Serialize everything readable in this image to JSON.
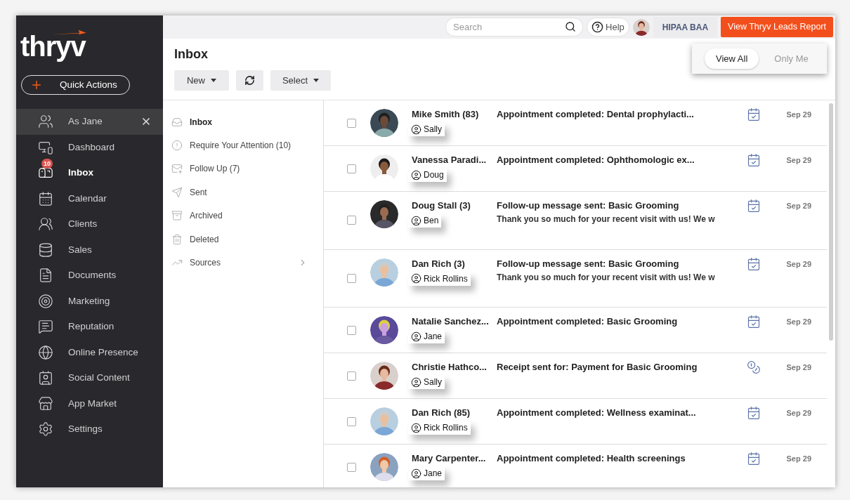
{
  "logo": {
    "text": "thryv"
  },
  "quick_actions": {
    "label": "Quick Actions"
  },
  "sidebar": {
    "items": [
      {
        "label": "As Jane",
        "selected": false,
        "kind": "impersonation",
        "closable": true
      },
      {
        "label": "Dashboard",
        "selected": false,
        "kind": "link"
      },
      {
        "label": "Inbox",
        "selected": true,
        "badge": "10",
        "kind": "link"
      },
      {
        "label": "Calendar",
        "selected": false,
        "kind": "link"
      },
      {
        "label": "Clients",
        "selected": false,
        "kind": "link"
      },
      {
        "label": "Sales",
        "selected": false,
        "kind": "link"
      },
      {
        "label": "Documents",
        "selected": false,
        "kind": "link"
      },
      {
        "label": "Marketing",
        "selected": false,
        "kind": "link"
      },
      {
        "label": "Reputation",
        "selected": false,
        "kind": "link"
      },
      {
        "label": "Online Presence",
        "selected": false,
        "kind": "link"
      },
      {
        "label": "Social Content",
        "selected": false,
        "kind": "link"
      },
      {
        "label": "App Market",
        "selected": false,
        "kind": "link"
      },
      {
        "label": "Settings",
        "selected": false,
        "kind": "link"
      }
    ]
  },
  "top_bar": {
    "search": {
      "placeholder": "Search"
    },
    "help": "Help",
    "hipaa": "HIPAA BAA",
    "leads_button": "View Thryv Leads Report"
  },
  "page": {
    "title": "Inbox",
    "buttons": [
      {
        "label": "New",
        "kind": "dropdown"
      },
      {
        "kind": "refresh"
      },
      {
        "label": "Select",
        "kind": "dropdown"
      }
    ]
  },
  "view_toggle": [
    {
      "label": "View All",
      "selected": true
    },
    {
      "label": "Only Me",
      "selected": false
    }
  ],
  "folders": [
    {
      "label": "Inbox",
      "selected": true
    },
    {
      "label": "Require Your Attention (10)",
      "selected": false
    },
    {
      "label": "Follow Up (7)",
      "selected": false
    },
    {
      "label": "Sent",
      "selected": false
    },
    {
      "label": "Archived",
      "selected": false
    },
    {
      "label": "Deleted",
      "selected": false
    },
    {
      "label": "Sources",
      "selected": false,
      "expandable": true
    }
  ],
  "messages": [
    {
      "name": "Mike Smith (83)",
      "assignee": "Sally",
      "subject": "Appointment completed: Dental prophylacti...",
      "kind": "appointment",
      "date": "Sep 29",
      "checked": false
    },
    {
      "name": "Vanessa Paradi...",
      "assignee": "Doug",
      "subject": "Appointment completed: Ophthomologic ex...",
      "kind": "appointment",
      "date": "Sep 29",
      "checked": false
    },
    {
      "name": "Doug Stall (3)",
      "assignee": "Ben",
      "subject": "Follow-up message sent: Basic Grooming",
      "preview": "Thank you so much for your recent visit with us! We w",
      "kind": "appointment",
      "date": "Sep 29",
      "checked": false
    },
    {
      "name": "Dan Rich (3)",
      "assignee": "Rick Rollins",
      "subject": "Follow-up message sent: Basic Grooming",
      "preview": "Thank you so much for your recent visit with us! We w",
      "kind": "appointment",
      "date": "Sep 29",
      "checked": false
    },
    {
      "name": "Natalie Sanchez...",
      "assignee": "Jane",
      "subject": "Appointment completed: Basic Grooming",
      "kind": "appointment",
      "date": "Sep 29",
      "checked": false
    },
    {
      "name": "Christie Hathco...",
      "assignee": "Sally",
      "subject": "Receipt sent for: Payment for Basic Grooming",
      "kind": "payment",
      "date": "Sep 29",
      "checked": false
    },
    {
      "name": "Dan Rich (85)",
      "assignee": "Rick Rollins",
      "subject": "Appointment completed: Wellness examinat...",
      "kind": "appointment",
      "date": "Sep 29",
      "checked": false
    },
    {
      "name": "Mary Carpenter...",
      "assignee": "Jane",
      "subject": "Appointment completed: Health screenings",
      "kind": "appointment",
      "date": "Sep 29",
      "checked": false
    }
  ]
}
